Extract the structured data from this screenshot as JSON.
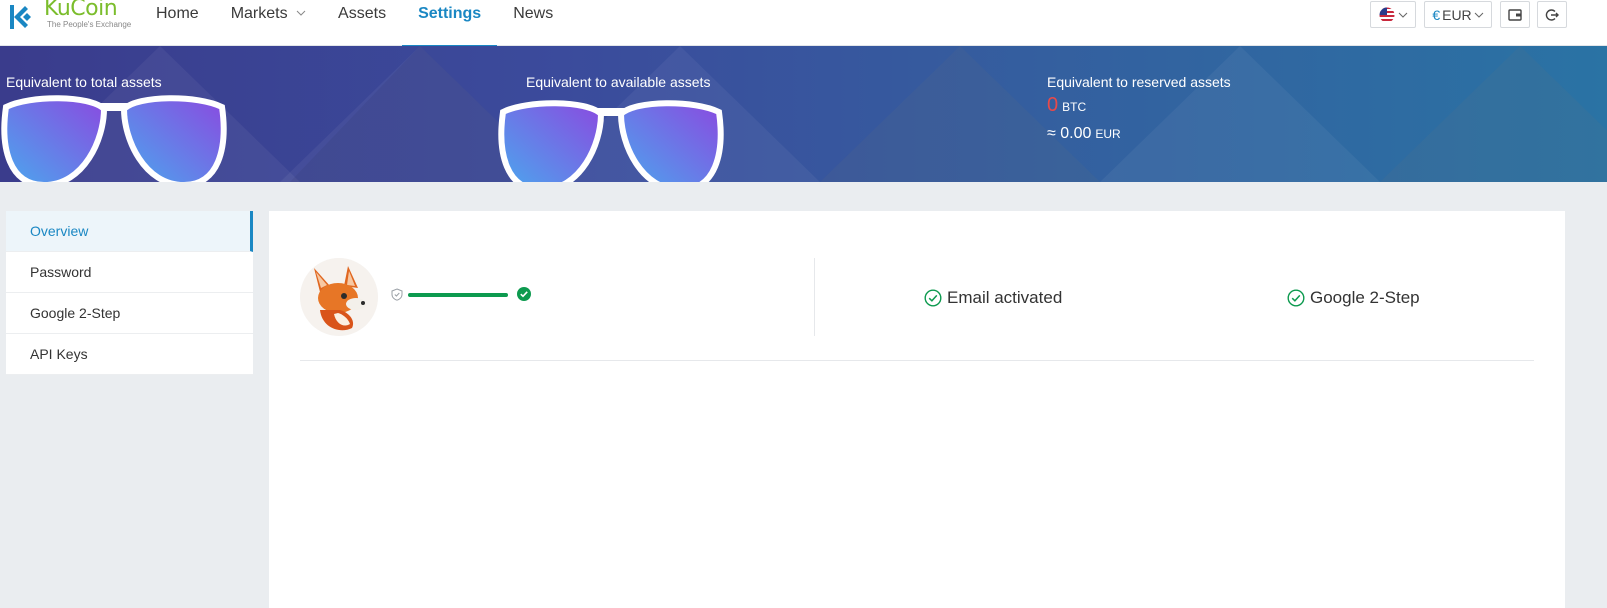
{
  "brand": {
    "name": "KuCoin",
    "tagline": "The People's Exchange"
  },
  "nav": {
    "items": [
      {
        "label": "Home",
        "active": false
      },
      {
        "label": "Markets",
        "active": false,
        "dropdown": true
      },
      {
        "label": "Assets",
        "active": false
      },
      {
        "label": "Settings",
        "active": true
      },
      {
        "label": "News",
        "active": false
      }
    ]
  },
  "toolbar": {
    "language_icon": "us-flag-icon",
    "currency_symbol": "€",
    "currency_label": "EUR",
    "wallet_icon": "wallet-icon",
    "logout_icon": "logout-icon"
  },
  "assets": {
    "total": {
      "label": "Equivalent to total assets"
    },
    "available": {
      "label": "Equivalent to available assets"
    },
    "reserved": {
      "label": "Equivalent to reserved assets",
      "btc_value": "0",
      "btc_unit": "BTC",
      "eur_value": "≈ 0.00",
      "eur_unit": "EUR"
    }
  },
  "sidebar": {
    "items": [
      {
        "label": "Overview",
        "active": true
      },
      {
        "label": "Password",
        "active": false
      },
      {
        "label": "Google 2-Step",
        "active": false
      },
      {
        "label": "API Keys",
        "active": false
      }
    ]
  },
  "overview": {
    "security_level": 1.0,
    "email_status": "Email activated",
    "google_status": "Google 2-Step"
  },
  "colors": {
    "accent": "#1a87c3",
    "brand_green": "#7bbd2c",
    "success": "#0d9a4f",
    "zero_value": "#e84a4a",
    "banner_start": "#3a3c8c",
    "banner_end": "#2a73a4"
  }
}
